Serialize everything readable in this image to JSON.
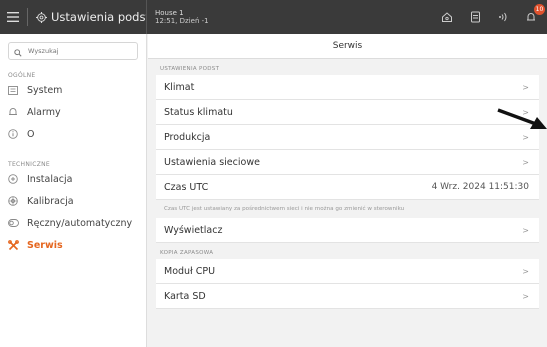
{
  "topbar": {
    "title": "Ustawienia podst",
    "house_name": "House 1",
    "house_info": "12:51, Dzień -1",
    "notification_count": "10"
  },
  "sidebar": {
    "search_placeholder": "Wyszukaj",
    "sections": [
      {
        "label": "OGÓLNE",
        "items": [
          {
            "label": "System",
            "icon": "system-icon"
          },
          {
            "label": "Alarmy",
            "icon": "bell-icon"
          },
          {
            "label": "O",
            "icon": "info-icon"
          }
        ]
      },
      {
        "label": "TECHNICZNE",
        "items": [
          {
            "label": "Instalacja",
            "icon": "installation-icon"
          },
          {
            "label": "Kalibracja",
            "icon": "calibration-icon"
          },
          {
            "label": "Ręczny/automatyczny",
            "icon": "toggle-icon"
          },
          {
            "label": "Serwis",
            "icon": "tools-icon",
            "active": true
          }
        ]
      }
    ]
  },
  "main": {
    "title": "Serwis",
    "group1_label": "USTAWIENIA PODST",
    "group1_rows": [
      {
        "label": "Klimat"
      },
      {
        "label": "Status klimatu"
      },
      {
        "label": "Produkcja"
      },
      {
        "label": "Ustawienia sieciowe"
      }
    ],
    "utc_label": "Czas UTC",
    "utc_value": "4 Wrz. 2024 11:51:30",
    "utc_note": "Czas UTC jest ustawiany za pośrednictwem sieci i nie można go zmienić w sterowniku",
    "display_label": "Wyświetlacz",
    "group2_label": "KOPIA ZAPASOWA",
    "group2_rows": [
      {
        "label": "Moduł CPU"
      },
      {
        "label": "Karta SD"
      }
    ],
    "chevron": ">"
  },
  "colors": {
    "topbar": "#3a3a3a",
    "accent": "#e5661f",
    "badge": "#e0522e"
  }
}
